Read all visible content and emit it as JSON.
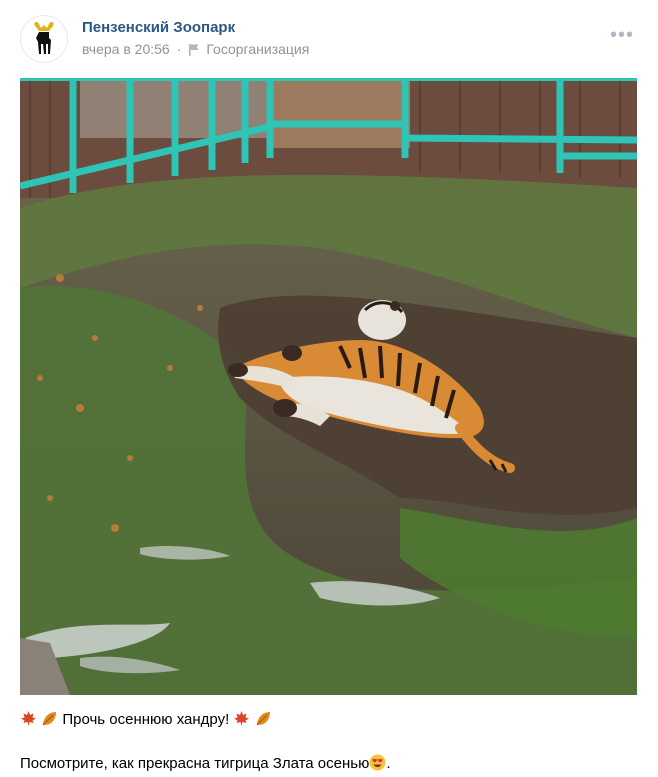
{
  "post": {
    "author": "Пензенский Зоопарк",
    "time": "вчера в 20:56",
    "separator": "·",
    "org_type": "Госорганизация",
    "more_label": "•••",
    "line1_text": "Прочь осеннюю хандру!",
    "line2_text": "Посмотрите, как прекрасна тигрица Злата осенью",
    "line2_end": "."
  },
  "icons": {
    "avatar": "moose-logo-icon",
    "org": "flag-icon",
    "more": "more-dots-icon",
    "leaf1": "maple-leaf-icon",
    "leaf2": "fallen-leaf-icon",
    "emoji": "heart-eyes-icon"
  },
  "colors": {
    "link": "#2a5885",
    "muted": "#939393",
    "fence": "#2ec4b6"
  }
}
